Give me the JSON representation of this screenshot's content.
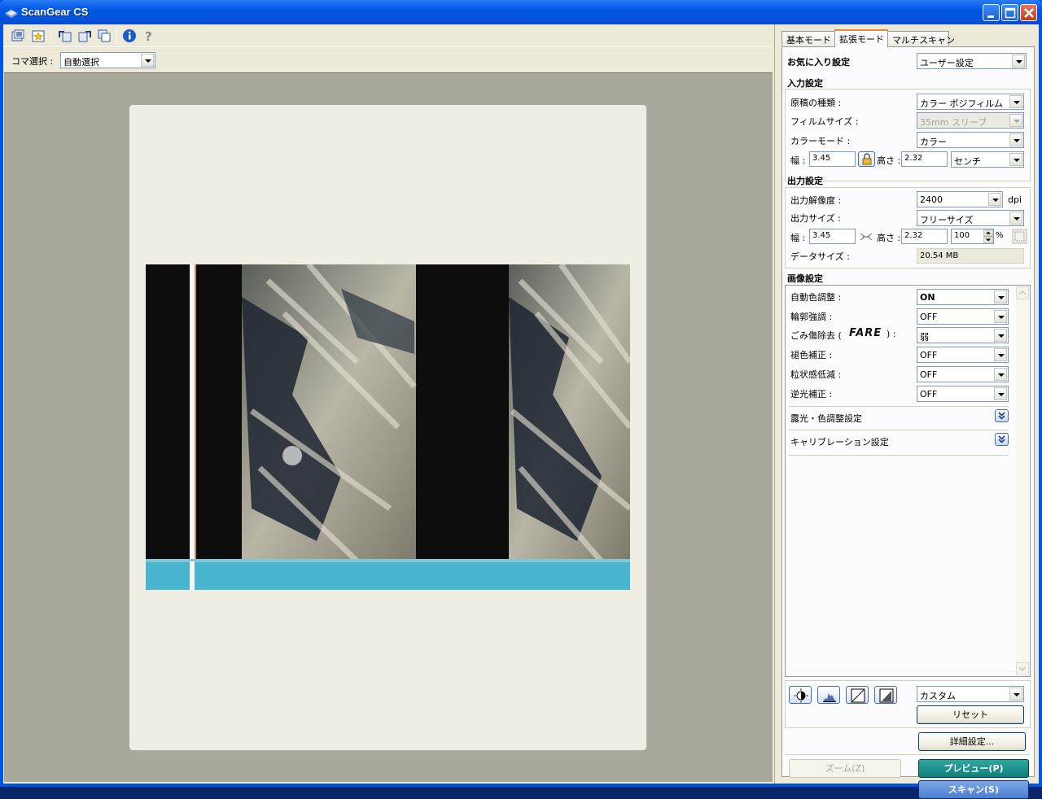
{
  "window": {
    "title": "ScanGear CS",
    "icons": {
      "app": "scanner-icon",
      "minimize": "minimize-icon",
      "maximize": "maximize-icon",
      "close": "close-icon"
    }
  },
  "toolbar": {
    "icons": [
      "thumbnail-view-icon",
      "auto-crop-icon",
      "rotate-left-icon",
      "rotate-right-icon",
      "clear-crop-icon",
      "info-icon",
      "help-icon"
    ]
  },
  "frame_select": {
    "label": "コマ選択 :",
    "value": "自動選択"
  },
  "tabs": [
    "基本モード",
    "拡張モード",
    "マルチスキャン"
  ],
  "favorites": {
    "label": "お気に入り設定",
    "value": "ユーザー設定"
  },
  "input_settings": {
    "title": "入力設定",
    "doc_type": {
      "label": "原稿の種類 :",
      "value": "カラー  ポジフィルム"
    },
    "film_size": {
      "label": "フィルムサイズ :",
      "value": "35mm スリーブ"
    },
    "color_mode": {
      "label": "カラーモード :",
      "value": "カラー"
    },
    "width_label": "幅 :",
    "width": "3.45",
    "height_label": "高さ :",
    "height": "2.32",
    "unit": "センチ"
  },
  "output_settings": {
    "title": "出力設定",
    "resolution": {
      "label": "出力解像度 :",
      "value": "2400",
      "unit": "dpi"
    },
    "size": {
      "label": "出力サイズ :",
      "value": "フリーサイズ"
    },
    "width_label": "幅 :",
    "width": "3.45",
    "height_label": "高さ :",
    "height": "2.32",
    "scale": "100",
    "scale_unit": "%",
    "data_size": {
      "label": "データサイズ :",
      "value": "20.54 MB"
    }
  },
  "image_settings": {
    "title": "画像設定",
    "rows": [
      {
        "label": "自動色調整 :",
        "value": "ON"
      },
      {
        "label": "輪郭強調 :",
        "value": "OFF"
      },
      {
        "label": "ごみ傷除去 (",
        "label_suffix": ") :",
        "badge": "FARE",
        "value": "弱"
      },
      {
        "label": "褪色補正 :",
        "value": "OFF"
      },
      {
        "label": "粒状感低減 :",
        "value": "OFF"
      },
      {
        "label": "逆光補正 :",
        "value": "OFF"
      }
    ],
    "exposure_label": "露光・色調整設定",
    "calibration_label": "キャリブレーション設定"
  },
  "adjust": {
    "icons": [
      "brightness-contrast-icon",
      "histogram-icon",
      "tone-curve-icon",
      "threshold-icon"
    ],
    "preset": "カスタム",
    "reset_label": "リセット"
  },
  "actions": {
    "preferences_label": "詳細設定...",
    "zoom_label": "ズーム(Z)",
    "preview_label": "プレビュー(P)",
    "scan_label": "スキャン(S)"
  },
  "colors": {
    "teal_button": "#11807a",
    "blue_button": "#4a7dd1",
    "title_bar": "#0058e6"
  }
}
